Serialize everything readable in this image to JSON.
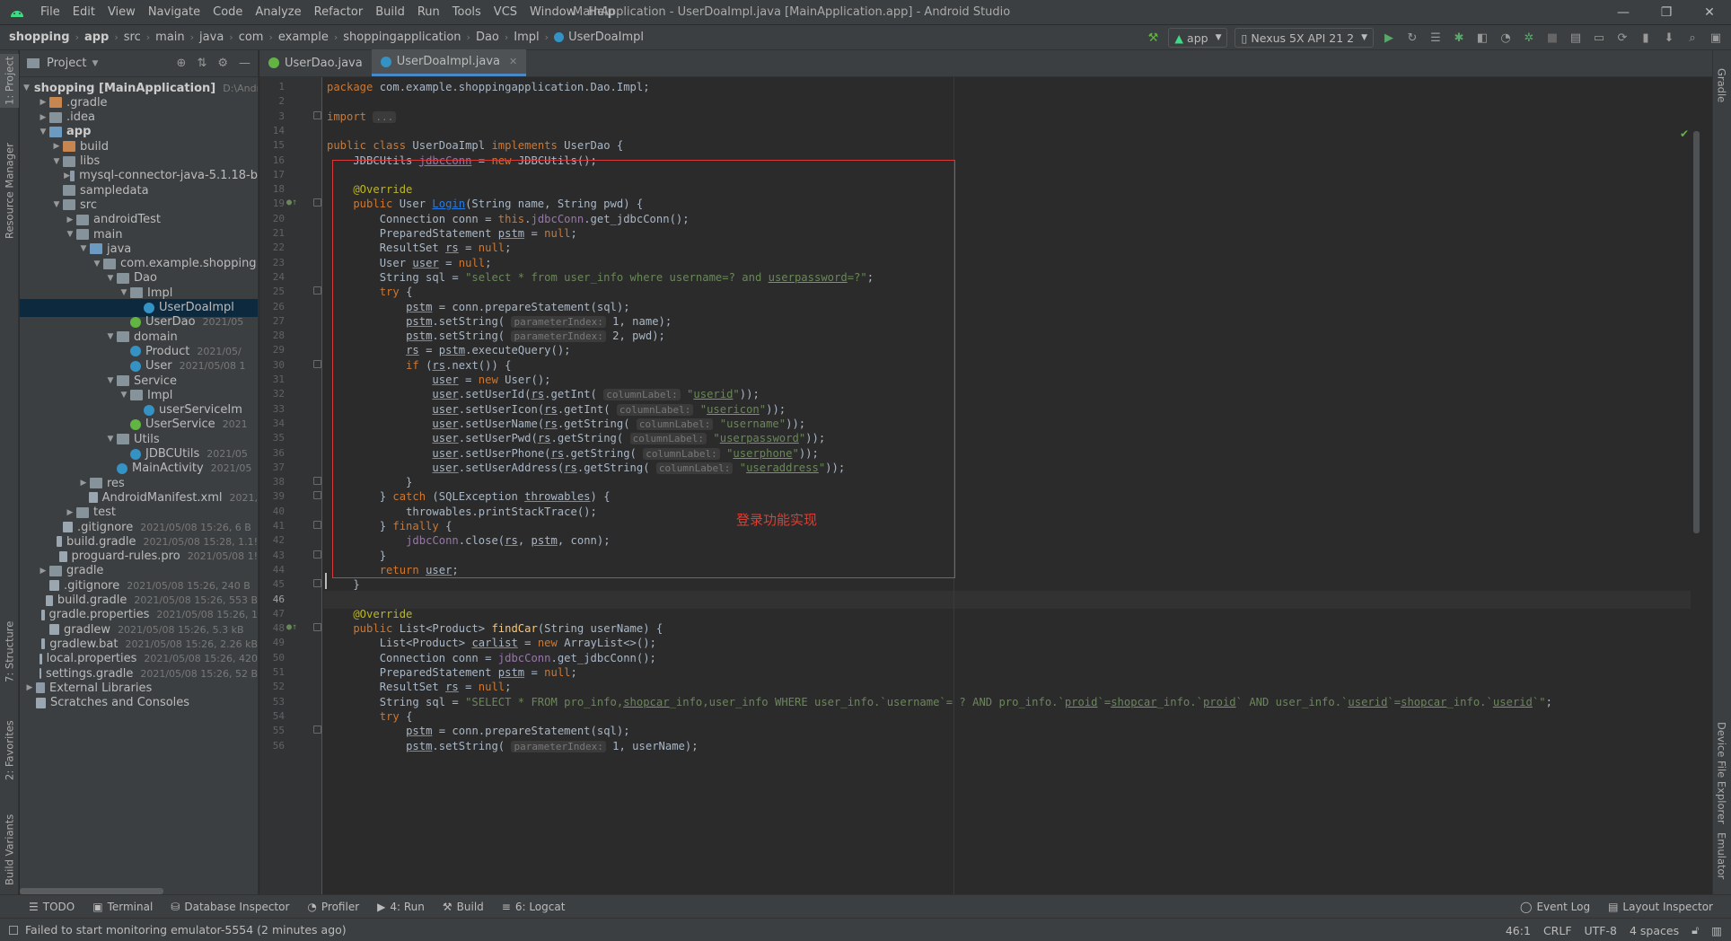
{
  "window": {
    "title": "MainApplication - UserDoaImpl.java [MainApplication.app] - Android Studio",
    "minimize": "—",
    "restore": "❐",
    "close": "✕"
  },
  "menu": [
    "File",
    "Edit",
    "View",
    "Navigate",
    "Code",
    "Analyze",
    "Refactor",
    "Build",
    "Run",
    "Tools",
    "VCS",
    "Window",
    "Help"
  ],
  "breadcrumb": [
    "shopping",
    "app",
    "src",
    "main",
    "java",
    "com",
    "example",
    "shoppingapplication",
    "Dao",
    "Impl",
    "UserDoaImpl"
  ],
  "toolbar": {
    "config": "app",
    "device": "Nexus 5X API 21 2"
  },
  "project_panel": {
    "title": "Project"
  },
  "left_tabs": [
    "1: Project",
    "Resource Manager",
    "7: Structure",
    "2: Favorites",
    "Build Variants"
  ],
  "right_tabs": [
    "Gradle",
    "Device File Explorer",
    "Emulator"
  ],
  "tree": [
    {
      "label": "shopping [MainApplication]",
      "meta": "D:\\Andro",
      "depth": 0,
      "open": true,
      "icon": "bfolder",
      "bold": true
    },
    {
      "label": ".gradle",
      "meta": "",
      "depth": 1,
      "open": false,
      "icon": "ofolder"
    },
    {
      "label": ".idea",
      "meta": "",
      "depth": 1,
      "open": false,
      "icon": "folder"
    },
    {
      "label": "app",
      "meta": "",
      "depth": 1,
      "open": true,
      "icon": "bfolder",
      "bold": true
    },
    {
      "label": "build",
      "meta": "",
      "depth": 2,
      "open": false,
      "icon": "ofolder"
    },
    {
      "label": "libs",
      "meta": "",
      "depth": 2,
      "open": true,
      "icon": "folder"
    },
    {
      "label": "mysql-connector-java-5.1.18-b",
      "meta": "",
      "depth": 3,
      "open": false,
      "icon": "lib"
    },
    {
      "label": "sampledata",
      "meta": "",
      "depth": 2,
      "open": null,
      "icon": "folder"
    },
    {
      "label": "src",
      "meta": "",
      "depth": 2,
      "open": true,
      "icon": "folder"
    },
    {
      "label": "androidTest",
      "meta": "",
      "depth": 3,
      "open": false,
      "icon": "folder"
    },
    {
      "label": "main",
      "meta": "",
      "depth": 3,
      "open": true,
      "icon": "folder"
    },
    {
      "label": "java",
      "meta": "",
      "depth": 4,
      "open": true,
      "icon": "bfolder"
    },
    {
      "label": "com.example.shopping",
      "meta": "",
      "depth": 5,
      "open": true,
      "icon": "folder"
    },
    {
      "label": "Dao",
      "meta": "",
      "depth": 6,
      "open": true,
      "icon": "folder"
    },
    {
      "label": "Impl",
      "meta": "",
      "depth": 7,
      "open": true,
      "icon": "folder"
    },
    {
      "label": "UserDoaImpl",
      "meta": "",
      "depth": 8,
      "open": null,
      "icon": "cls",
      "selected": true
    },
    {
      "label": "UserDao",
      "meta": "2021/05",
      "depth": 7,
      "open": null,
      "icon": "ifc"
    },
    {
      "label": "domain",
      "meta": "",
      "depth": 6,
      "open": true,
      "icon": "folder"
    },
    {
      "label": "Product",
      "meta": "2021/05/",
      "depth": 7,
      "open": null,
      "icon": "cls"
    },
    {
      "label": "User",
      "meta": "2021/05/08 1",
      "depth": 7,
      "open": null,
      "icon": "cls"
    },
    {
      "label": "Service",
      "meta": "",
      "depth": 6,
      "open": true,
      "icon": "folder"
    },
    {
      "label": "Impl",
      "meta": "",
      "depth": 7,
      "open": true,
      "icon": "folder"
    },
    {
      "label": "userServiceIm",
      "meta": "",
      "depth": 8,
      "open": null,
      "icon": "cls"
    },
    {
      "label": "UserService",
      "meta": "2021",
      "depth": 7,
      "open": null,
      "icon": "ifc"
    },
    {
      "label": "Utils",
      "meta": "",
      "depth": 6,
      "open": true,
      "icon": "folder"
    },
    {
      "label": "JDBCUtils",
      "meta": "2021/05",
      "depth": 7,
      "open": null,
      "icon": "cls"
    },
    {
      "label": "MainActivity",
      "meta": "2021/05",
      "depth": 6,
      "open": null,
      "icon": "cls"
    },
    {
      "label": "res",
      "meta": "",
      "depth": 4,
      "open": false,
      "icon": "folder"
    },
    {
      "label": "AndroidManifest.xml",
      "meta": "2021,",
      "depth": 4,
      "open": null,
      "icon": "file"
    },
    {
      "label": "test",
      "meta": "",
      "depth": 3,
      "open": false,
      "icon": "folder"
    },
    {
      "label": ".gitignore",
      "meta": "2021/05/08 15:26, 6 B",
      "depth": 2,
      "open": null,
      "icon": "file"
    },
    {
      "label": "build.gradle",
      "meta": "2021/05/08 15:28, 1.1!",
      "depth": 2,
      "open": null,
      "icon": "file"
    },
    {
      "label": "proguard-rules.pro",
      "meta": "2021/05/08 1!",
      "depth": 2,
      "open": null,
      "icon": "file"
    },
    {
      "label": "gradle",
      "meta": "",
      "depth": 1,
      "open": false,
      "icon": "folder"
    },
    {
      "label": ".gitignore",
      "meta": "2021/05/08 15:26, 240 B",
      "depth": 1,
      "open": null,
      "icon": "file"
    },
    {
      "label": "build.gradle",
      "meta": "2021/05/08 15:26, 553 B",
      "depth": 1,
      "open": null,
      "icon": "file"
    },
    {
      "label": "gradle.properties",
      "meta": "2021/05/08 15:26, 1",
      "depth": 1,
      "open": null,
      "icon": "file"
    },
    {
      "label": "gradlew",
      "meta": "2021/05/08 15:26, 5.3 kB",
      "depth": 1,
      "open": null,
      "icon": "file"
    },
    {
      "label": "gradlew.bat",
      "meta": "2021/05/08 15:26, 2.26 kB",
      "depth": 1,
      "open": null,
      "icon": "file"
    },
    {
      "label": "local.properties",
      "meta": "2021/05/08 15:26, 420",
      "depth": 1,
      "open": null,
      "icon": "file"
    },
    {
      "label": "settings.gradle",
      "meta": "2021/05/08 15:26, 52 B",
      "depth": 1,
      "open": null,
      "icon": "file"
    },
    {
      "label": "External Libraries",
      "meta": "",
      "depth": 0,
      "open": false,
      "icon": "lib"
    },
    {
      "label": "Scratches and Consoles",
      "meta": "",
      "depth": 0,
      "open": null,
      "icon": "file"
    }
  ],
  "editor_tabs": [
    {
      "label": "UserDao.java",
      "icon": "ifc",
      "active": false
    },
    {
      "label": "UserDoaImpl.java",
      "icon": "cls",
      "active": true
    }
  ],
  "line_numbers": [
    "1",
    "2",
    "3",
    "14",
    "15",
    "16",
    "17",
    "18",
    "19",
    "20",
    "21",
    "22",
    "23",
    "24",
    "25",
    "26",
    "27",
    "28",
    "29",
    "30",
    "31",
    "32",
    "33",
    "34",
    "35",
    "36",
    "37",
    "38",
    "39",
    "40",
    "41",
    "42",
    "43",
    "44",
    "45",
    "46",
    "47",
    "48",
    "49",
    "50",
    "51",
    "52",
    "53",
    "54",
    "55",
    "56"
  ],
  "current_line": "46",
  "code_lines": [
    [
      [
        "kw",
        "package "
      ],
      [
        "",
        "com.example.shoppingapplication.Dao.Impl;"
      ]
    ],
    [],
    [
      [
        "kw",
        "import "
      ],
      [
        "hint",
        "..."
      ]
    ],
    [],
    [
      [
        "kw",
        "public class "
      ],
      [
        "",
        "UserDoaImpl "
      ],
      [
        "kw",
        "implements "
      ],
      [
        "",
        "UserDao {"
      ]
    ],
    [
      [
        "",
        "    JDBCUtils "
      ],
      [
        "fld ul",
        "jdbcConn"
      ],
      [
        "",
        " = "
      ],
      [
        "kw",
        "new "
      ],
      [
        "",
        "JDBCUtils();"
      ]
    ],
    [],
    [
      [
        "an",
        "    @Override"
      ]
    ],
    [
      [
        "kw",
        "    public "
      ],
      [
        "",
        "User "
      ],
      [
        "fn lnk",
        "Login"
      ],
      [
        "",
        "(String name, String pwd) {"
      ]
    ],
    [
      [
        "",
        "        Connection conn = "
      ],
      [
        "kw",
        "this"
      ],
      [
        "",
        "."
      ],
      [
        "fld",
        "jdbcConn"
      ],
      [
        "",
        ".get_jdbcConn();"
      ]
    ],
    [
      [
        "",
        "        PreparedStatement "
      ],
      [
        "ul",
        "pstm"
      ],
      [
        "",
        " = "
      ],
      [
        "kw",
        "null"
      ],
      [
        "",
        ";"
      ]
    ],
    [
      [
        "",
        "        ResultSet "
      ],
      [
        "ul",
        "rs"
      ],
      [
        "",
        " = "
      ],
      [
        "kw",
        "null"
      ],
      [
        "",
        ";"
      ]
    ],
    [
      [
        "",
        "        User "
      ],
      [
        "ul",
        "user"
      ],
      [
        "",
        " = "
      ],
      [
        "kw",
        "null"
      ],
      [
        "",
        ";"
      ]
    ],
    [
      [
        "",
        "        String sql = "
      ],
      [
        "st",
        "\"select * from user_info where username=? and "
      ],
      [
        "st ul",
        "userpassword"
      ],
      [
        "st",
        "=?\""
      ],
      [
        "",
        ";"
      ]
    ],
    [
      [
        "kw",
        "        try "
      ],
      [
        "",
        "{"
      ]
    ],
    [
      [
        "",
        "            "
      ],
      [
        "ul",
        "pstm"
      ],
      [
        "",
        " = conn.prepareStatement(sql);"
      ]
    ],
    [
      [
        "",
        "            "
      ],
      [
        "ul",
        "pstm"
      ],
      [
        "",
        ".setString( "
      ],
      [
        "hint",
        "parameterIndex:"
      ],
      [
        "",
        " 1, name);"
      ]
    ],
    [
      [
        "",
        "            "
      ],
      [
        "ul",
        "pstm"
      ],
      [
        "",
        ".setString( "
      ],
      [
        "hint",
        "parameterIndex:"
      ],
      [
        "",
        " 2, pwd);"
      ]
    ],
    [
      [
        "",
        "            "
      ],
      [
        "ul",
        "rs"
      ],
      [
        "",
        " = "
      ],
      [
        "ul",
        "pstm"
      ],
      [
        "",
        ".executeQuery();"
      ]
    ],
    [
      [
        "kw",
        "            if "
      ],
      [
        "",
        "("
      ],
      [
        "ul",
        "rs"
      ],
      [
        "",
        ".next()) {"
      ]
    ],
    [
      [
        "",
        "                "
      ],
      [
        "ul",
        "user"
      ],
      [
        "",
        " = "
      ],
      [
        "kw",
        "new "
      ],
      [
        "",
        "User();"
      ]
    ],
    [
      [
        "",
        "                "
      ],
      [
        "ul",
        "user"
      ],
      [
        "",
        ".setUserId("
      ],
      [
        "ul",
        "rs"
      ],
      [
        "",
        ".getInt( "
      ],
      [
        "hint",
        "columnLabel:"
      ],
      [
        "",
        " "
      ],
      [
        "st",
        "\""
      ],
      [
        "st ul",
        "userid"
      ],
      [
        "st",
        "\""
      ],
      [
        "",
        "));"
      ]
    ],
    [
      [
        "",
        "                "
      ],
      [
        "ul",
        "user"
      ],
      [
        "",
        ".setUserIcon("
      ],
      [
        "ul",
        "rs"
      ],
      [
        "",
        ".getInt( "
      ],
      [
        "hint",
        "columnLabel:"
      ],
      [
        "",
        " "
      ],
      [
        "st",
        "\""
      ],
      [
        "st ul",
        "usericon"
      ],
      [
        "st",
        "\""
      ],
      [
        "",
        "));"
      ]
    ],
    [
      [
        "",
        "                "
      ],
      [
        "ul",
        "user"
      ],
      [
        "",
        ".setUserName("
      ],
      [
        "ul",
        "rs"
      ],
      [
        "",
        ".getString( "
      ],
      [
        "hint",
        "columnLabel:"
      ],
      [
        "",
        " "
      ],
      [
        "st",
        "\"username\""
      ],
      [
        "",
        "));"
      ]
    ],
    [
      [
        "",
        "                "
      ],
      [
        "ul",
        "user"
      ],
      [
        "",
        ".setUserPwd("
      ],
      [
        "ul",
        "rs"
      ],
      [
        "",
        ".getString( "
      ],
      [
        "hint",
        "columnLabel:"
      ],
      [
        "",
        " "
      ],
      [
        "st",
        "\""
      ],
      [
        "st ul",
        "userpassword"
      ],
      [
        "st",
        "\""
      ],
      [
        "",
        "));"
      ]
    ],
    [
      [
        "",
        "                "
      ],
      [
        "ul",
        "user"
      ],
      [
        "",
        ".setUserPhone("
      ],
      [
        "ul",
        "rs"
      ],
      [
        "",
        ".getString( "
      ],
      [
        "hint",
        "columnLabel:"
      ],
      [
        "",
        " "
      ],
      [
        "st",
        "\""
      ],
      [
        "st ul",
        "userphone"
      ],
      [
        "st",
        "\""
      ],
      [
        "",
        "));"
      ]
    ],
    [
      [
        "",
        "                "
      ],
      [
        "ul",
        "user"
      ],
      [
        "",
        ".setUserAddress("
      ],
      [
        "ul",
        "rs"
      ],
      [
        "",
        ".getString( "
      ],
      [
        "hint",
        "columnLabel:"
      ],
      [
        "",
        " "
      ],
      [
        "st",
        "\""
      ],
      [
        "st ul",
        "useraddress"
      ],
      [
        "st",
        "\""
      ],
      [
        "",
        "));"
      ]
    ],
    [
      [
        "",
        "            }"
      ]
    ],
    [
      [
        "",
        "        } "
      ],
      [
        "kw",
        "catch "
      ],
      [
        "",
        "(SQLException "
      ],
      [
        "ul",
        "throwables"
      ],
      [
        "",
        ") {"
      ]
    ],
    [
      [
        "",
        "            throwables.printStackTrace();"
      ]
    ],
    [
      [
        "",
        "        } "
      ],
      [
        "kw",
        "finally "
      ],
      [
        "",
        "{"
      ]
    ],
    [
      [
        "",
        "            "
      ],
      [
        "fld",
        "jdbcConn"
      ],
      [
        "",
        ".close("
      ],
      [
        "ul",
        "rs"
      ],
      [
        "",
        ", "
      ],
      [
        "ul",
        "pstm"
      ],
      [
        "",
        ", conn);"
      ]
    ],
    [
      [
        "",
        "        }"
      ]
    ],
    [
      [
        "kw",
        "        return "
      ],
      [
        "ul",
        "user"
      ],
      [
        "",
        ";"
      ]
    ],
    [
      [
        "",
        "    }"
      ]
    ],
    [],
    [
      [
        "an",
        "    @Override"
      ]
    ],
    [
      [
        "kw",
        "    public "
      ],
      [
        "",
        "List<Product> "
      ],
      [
        "fn",
        "findCar"
      ],
      [
        "",
        "(String userName) {"
      ]
    ],
    [
      [
        "",
        "        List<Product> "
      ],
      [
        "ul",
        "carlist"
      ],
      [
        "",
        " = "
      ],
      [
        "kw",
        "new "
      ],
      [
        "",
        "ArrayList<>();"
      ]
    ],
    [
      [
        "",
        "        Connection conn = "
      ],
      [
        "fld",
        "jdbcConn"
      ],
      [
        "",
        ".get_jdbcConn();"
      ]
    ],
    [
      [
        "",
        "        PreparedStatement "
      ],
      [
        "ul",
        "pstm"
      ],
      [
        "",
        " = "
      ],
      [
        "kw",
        "null"
      ],
      [
        "",
        ";"
      ]
    ],
    [
      [
        "",
        "        ResultSet "
      ],
      [
        "ul",
        "rs"
      ],
      [
        "",
        " = "
      ],
      [
        "kw",
        "null"
      ],
      [
        "",
        ";"
      ]
    ],
    [
      [
        "",
        "        String sql = "
      ],
      [
        "st",
        "\"SELECT * FROM pro_info,"
      ],
      [
        "st ul",
        "shopcar"
      ],
      [
        "st",
        "_info,user_info WHERE user_info.`username`= ? AND pro_info.`"
      ],
      [
        "st ul",
        "proid"
      ],
      [
        "st",
        "`="
      ],
      [
        "st ul",
        "shopcar"
      ],
      [
        "st",
        "_info.`"
      ],
      [
        "st ul",
        "proid"
      ],
      [
        "st",
        "` AND user_info.`"
      ],
      [
        "st ul",
        "userid"
      ],
      [
        "st",
        "`="
      ],
      [
        "st ul",
        "shopcar"
      ],
      [
        "st",
        "_info.`"
      ],
      [
        "st ul",
        "userid"
      ],
      [
        "st",
        "`\""
      ],
      [
        "",
        ";"
      ]
    ],
    [
      [
        "kw",
        "        try "
      ],
      [
        "",
        "{"
      ]
    ],
    [
      [
        "",
        "            "
      ],
      [
        "ul",
        "pstm"
      ],
      [
        "",
        " = conn.prepareStatement(sql);"
      ]
    ],
    [
      [
        "",
        "            "
      ],
      [
        "ul",
        "pstm"
      ],
      [
        "",
        ".setString( "
      ],
      [
        "hint",
        "parameterIndex:"
      ],
      [
        "",
        " 1, userName);"
      ]
    ]
  ],
  "annotation": "登录功能实现",
  "bottom_tools": [
    {
      "icon": "☰",
      "label": "TODO"
    },
    {
      "icon": "▣",
      "label": "Terminal"
    },
    {
      "icon": "⛁",
      "label": "Database Inspector"
    },
    {
      "icon": "◔",
      "label": "Profiler"
    },
    {
      "icon": "▶",
      "label": "4: Run"
    },
    {
      "icon": "⚒",
      "label": "Build"
    },
    {
      "icon": "≡",
      "label": "6: Logcat"
    }
  ],
  "bottom_right": [
    {
      "icon": "◯",
      "label": "Event Log"
    },
    {
      "icon": "▤",
      "label": "Layout Inspector"
    }
  ],
  "status": {
    "message": "Failed to start monitoring emulator-5554 (2 minutes ago)",
    "position": "46:1",
    "line_sep": "CRLF",
    "encoding": "UTF-8",
    "indent": "4 spaces"
  },
  "colors": {
    "accent": "#4a88c7",
    "redbox": "#d73a3a",
    "annotation": "#e03c31"
  }
}
